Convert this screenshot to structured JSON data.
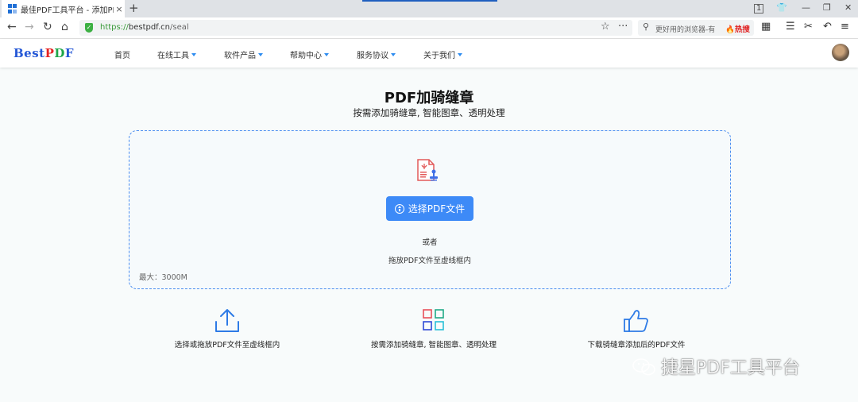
{
  "browser": {
    "tab_title": "最佳PDF工具平台 - 添加PDF骑",
    "url_protocol": "https://",
    "url_host": "bestpdf.cn",
    "url_path": "/seal",
    "search_placeholder": "更好用的浏览器-有",
    "search_hot": "热搜"
  },
  "site": {
    "logo": {
      "part1": "Best",
      "part2": "P",
      "part3": "D",
      "part4": "F"
    },
    "nav": [
      "首页",
      "在线工具",
      "软件产品",
      "帮助中心",
      "服务协议",
      "关于我们"
    ]
  },
  "main": {
    "title": "PDF加骑缝章",
    "subtitle": "按需添加骑缝章, 智能图章、透明处理",
    "upload_button": "选择PDF文件",
    "or_text": "或者",
    "drag_text": "拖放PDF文件至虚线框内",
    "max_size": "最大：3000M"
  },
  "features": [
    {
      "icon": "upload-icon",
      "label": "选择或拖放PDF文件至虚线框内"
    },
    {
      "icon": "grid-icon",
      "label": "按需添加骑缝章, 智能图章、透明处理"
    },
    {
      "icon": "thumbs-up-icon",
      "label": "下载骑缝章添加后的PDF文件"
    }
  ],
  "watermark": "捷星PDF工具平台",
  "colors": {
    "accent": "#3d8af7",
    "logo_blue": "#2457d6",
    "logo_red": "#e52424",
    "logo_green": "#1fa64a"
  }
}
